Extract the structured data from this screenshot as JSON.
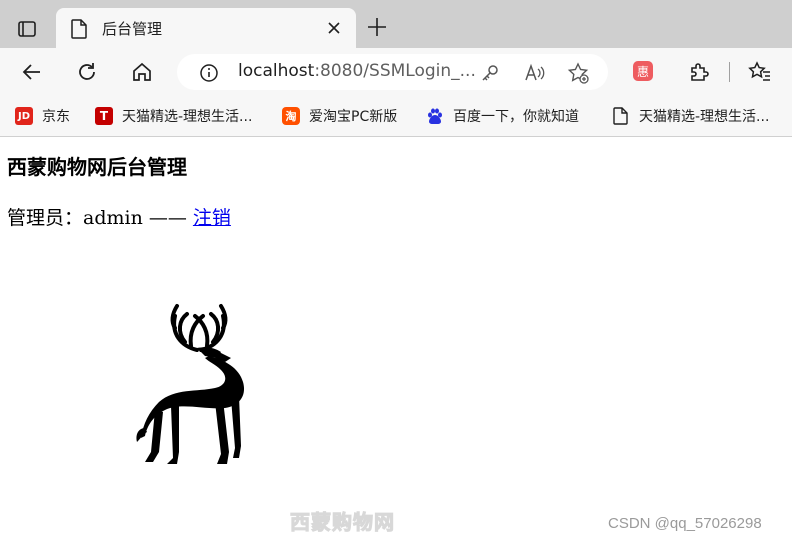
{
  "browser": {
    "tab": {
      "title": "后台管理",
      "icon": "document-icon"
    },
    "address_bar": {
      "host": "localhost",
      "rest": ":8080/SSMLogin_..."
    },
    "toolbar_icons": [
      "back-icon",
      "refresh-icon",
      "home-icon",
      "info-icon",
      "key-icon",
      "read-aloud-icon",
      "add-favorite-icon",
      "extension-icon",
      "puzzle-icon",
      "favorites-icon"
    ],
    "bookmarks": [
      {
        "label": "京东",
        "icon": "jd-icon",
        "icon_text": "JD",
        "color": "#e1251b"
      },
      {
        "label": "天猫精选-理想生活...",
        "icon": "tmall-icon",
        "icon_text": "T",
        "color": "#c40000"
      },
      {
        "label": "爱淘宝PC新版",
        "icon": "taobao-icon",
        "icon_text": "淘",
        "color": "#ff5000"
      },
      {
        "label": "百度一下，你就知道",
        "icon": "baidu-icon",
        "icon_text": "",
        "color": "#2932e1"
      },
      {
        "label": "天猫精选-理想生活...",
        "icon": "document-icon",
        "icon_text": "",
        "color": "#1f1f1f"
      }
    ]
  },
  "page": {
    "title": "西蒙购物网后台管理",
    "admin_prefix": "管理员：admin —— ",
    "logout_label": "注销"
  },
  "watermark": {
    "logo_text": "西蒙购物网",
    "csdn_text": "CSDN @qq_57026298"
  }
}
